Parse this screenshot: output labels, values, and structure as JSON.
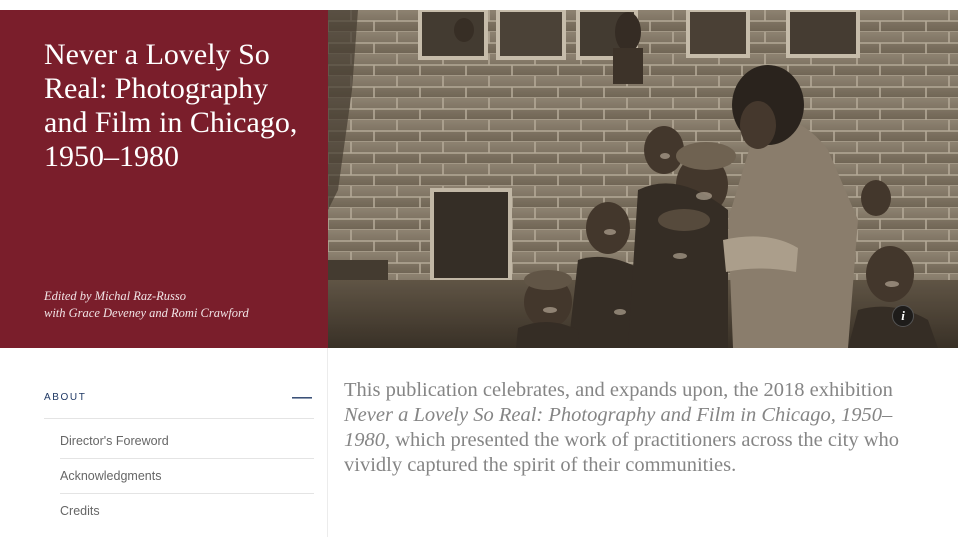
{
  "hero": {
    "title": "Never a Lovely So Real: Photography and Film in Chicago, 1950–1980",
    "editors_line1": "Edited by Michal Raz-Russo",
    "editors_line2": "with Grace Deveney and Romi Crawford",
    "info_button_label": "i"
  },
  "sidebar": {
    "section_label": "ABOUT",
    "collapse_symbol": "—",
    "items": [
      {
        "label": "Director's Foreword"
      },
      {
        "label": "Acknowledgments"
      },
      {
        "label": "Credits"
      }
    ]
  },
  "intro": {
    "part1": "This publication celebrates, and expands upon, the 2018 exhibition ",
    "title_italic": "Never a Lovely So Real: Photography and Film in Chicago, 1950–1980",
    "part2": ", which presented the work of practitioners across the city who vividly captured the spirit of their communities."
  },
  "colors": {
    "title_panel": "#7a1e2b",
    "accent_navy": "#1f3864",
    "body_text": "#858585"
  }
}
